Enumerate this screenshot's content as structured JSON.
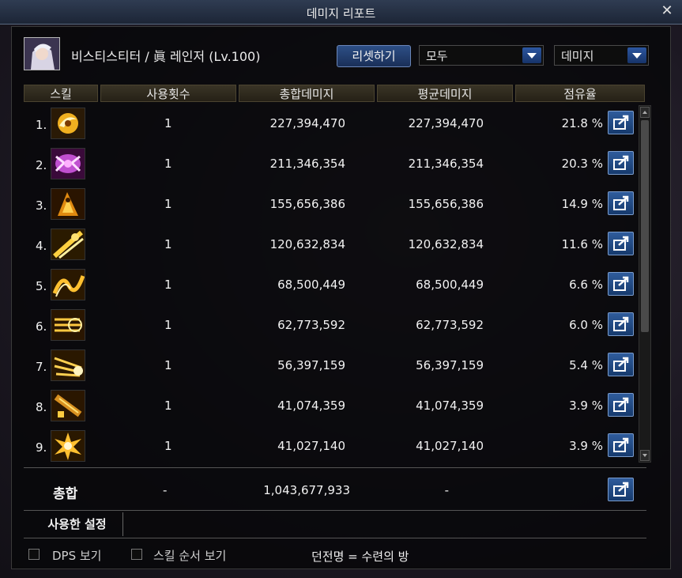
{
  "window": {
    "title": "데미지 리포트"
  },
  "character": {
    "name_label": "비스티스티터 / 眞 레인저 (Lv.100)"
  },
  "controls": {
    "reset_label": "리셋하기",
    "filter_value": "모두",
    "metric_value": "데미지"
  },
  "table": {
    "headers": [
      "스킬",
      "사용횟수",
      "총합데미지",
      "평균데미지",
      "점유율"
    ],
    "rows": [
      {
        "rank": "1.",
        "uses": "1",
        "total": "227,394,470",
        "avg": "227,394,470",
        "share": "21.8 %",
        "icon": "skill-icon-spiral"
      },
      {
        "rank": "2.",
        "uses": "1",
        "total": "211,346,354",
        "avg": "211,346,354",
        "share": "20.3 %",
        "icon": "skill-icon-purple-burst"
      },
      {
        "rank": "3.",
        "uses": "1",
        "total": "155,656,386",
        "avg": "155,656,386",
        "share": "14.9 %",
        "icon": "skill-icon-flame-figure"
      },
      {
        "rank": "4.",
        "uses": "1",
        "total": "120,632,834",
        "avg": "120,632,834",
        "share": "11.6 %",
        "icon": "skill-icon-slash"
      },
      {
        "rank": "5.",
        "uses": "1",
        "total": "68,500,449",
        "avg": "68,500,449",
        "share": "6.6 %",
        "icon": "skill-icon-wave"
      },
      {
        "rank": "6.",
        "uses": "1",
        "total": "62,773,592",
        "avg": "62,773,592",
        "share": "6.0 %",
        "icon": "skill-icon-barrage"
      },
      {
        "rank": "7.",
        "uses": "1",
        "total": "56,397,159",
        "avg": "56,397,159",
        "share": "5.4 %",
        "icon": "skill-icon-shot"
      },
      {
        "rank": "8.",
        "uses": "1",
        "total": "41,074,359",
        "avg": "41,074,359",
        "share": "3.9 %",
        "icon": "skill-icon-gun"
      },
      {
        "rank": "9.",
        "uses": "1",
        "total": "41,027,140",
        "avg": "41,027,140",
        "share": "3.9 %",
        "icon": "skill-icon-explosion"
      }
    ]
  },
  "total": {
    "label": "총합",
    "uses": "-",
    "total": "1,043,677,933",
    "avg": "-"
  },
  "settings_tab": "사용한 설정",
  "bottom": {
    "dps_label": "DPS 보기",
    "order_label": "스킬 순서 보기",
    "dungeon_label": "던전명 = 수련의 방"
  },
  "colors": {
    "accent_blue": "#2f5c9c",
    "header_gold": "#3a3426"
  }
}
